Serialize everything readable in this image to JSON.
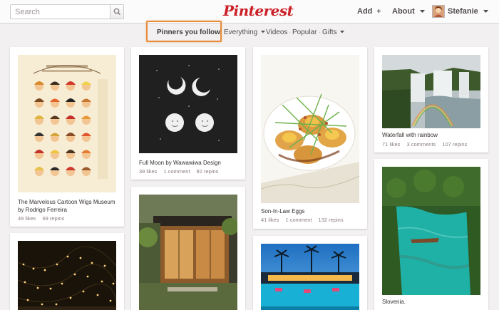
{
  "header": {
    "search_placeholder": "Search",
    "logo": "Pinterest",
    "add_label": "Add",
    "add_icon": "+",
    "about_label": "About",
    "user_name": "Stefanie"
  },
  "subnav": {
    "pinners_you_follow": "Pinners you follow",
    "everything": "Everything",
    "videos": "Videos",
    "popular": "Popular",
    "gifts": "Gifts"
  },
  "pins": [
    {
      "title": "The Marvelous Cartoon Wigs Museum by Rodrigo Ferreira",
      "likes": "49 likes",
      "comments": "",
      "repins": "69 repins"
    },
    {
      "title": "Full Moon by Wawawiwa Design",
      "likes": "39 likes",
      "comments": "1 comment",
      "repins": "82 repins"
    },
    {
      "title": "Son-In-Law Eggs",
      "likes": "41 likes",
      "comments": "1 comment",
      "repins": "132 repins"
    },
    {
      "title": "Waterfall with rainbow",
      "likes": "71 likes",
      "comments": "3 comments",
      "repins": "107 repins"
    },
    {
      "title": "Slovenia.",
      "likes": "",
      "comments": "",
      "repins": ""
    }
  ],
  "colors": {
    "brand_red": "#cb2027",
    "highlight_orange": "#e88c3a",
    "background": "#f2f0f0"
  }
}
